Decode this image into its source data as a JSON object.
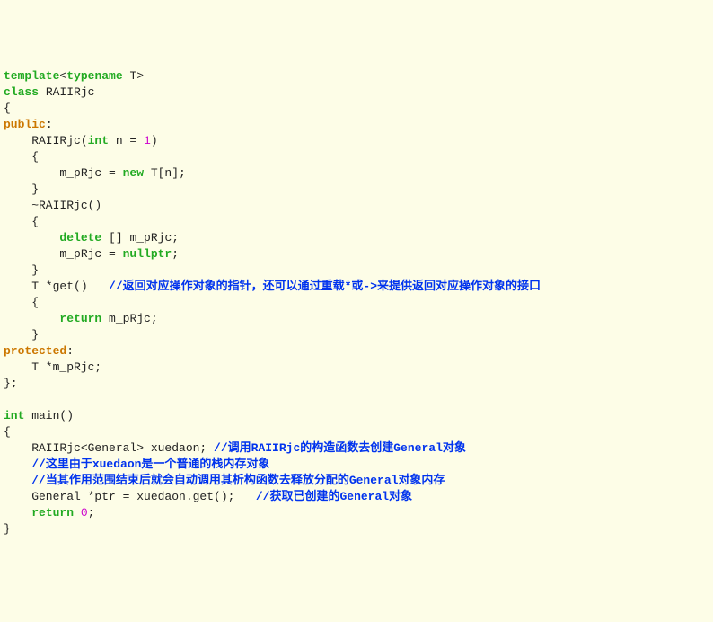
{
  "code": {
    "line01_template": "template",
    "line01_open": "<",
    "line01_typename": "typename",
    "line01_T": " T",
    "line01_close": ">",
    "line02_class": "class",
    "line02_name": " RAIIRjc",
    "line03": "{",
    "line04_public": "public",
    "line04_colon": ":",
    "line05": "    RAIIRjc(",
    "line05_int": "int",
    "line05_rest": " n = ",
    "line05_num": "1",
    "line05_close": ")",
    "line06": "    {",
    "line07a": "        m_pRjc = ",
    "line07_new": "new",
    "line07b": " T[n];",
    "line08": "    }",
    "line09": "    ~RAIIRjc()",
    "line10": "    {",
    "line11a": "        ",
    "line11_delete": "delete",
    "line11b": " [] m_pRjc;",
    "line12a": "        m_pRjc = ",
    "line12_null": "nullptr",
    "line12b": ";",
    "line13": "    }",
    "line14a": "    T *get()   ",
    "line14_comment": "//返回对应操作对象的指针，还可以通过重载*或->来提供返回对应操作对象的接口",
    "line15": "    {",
    "line16a": "        ",
    "line16_return": "return",
    "line16b": " m_pRjc;",
    "line17": "    }",
    "line18_protected": "protected",
    "line18_colon": ":",
    "line19": "    T *m_pRjc;",
    "line20": "};",
    "line21": "",
    "line22_int": "int",
    "line22_main": " main()",
    "line23": "{",
    "line24a": "    RAIIRjc<General> xuedaon; ",
    "line24_comment": "//调用RAIIRjc的构造函数去创建General对象",
    "line25a": "    ",
    "line25_comment": "//这里由于xuedaon是一个普通的栈内存对象",
    "line26a": "    ",
    "line26_comment": "//当其作用范围结束后就会自动调用其析构函数去释放分配的General对象内存",
    "line27a": "    General *ptr = xuedaon.get();   ",
    "line27_comment": "//获取已创建的General对象",
    "line28a": "    ",
    "line28_return": "return",
    "line28b": " ",
    "line28_num": "0",
    "line28c": ";",
    "line29": "}"
  }
}
